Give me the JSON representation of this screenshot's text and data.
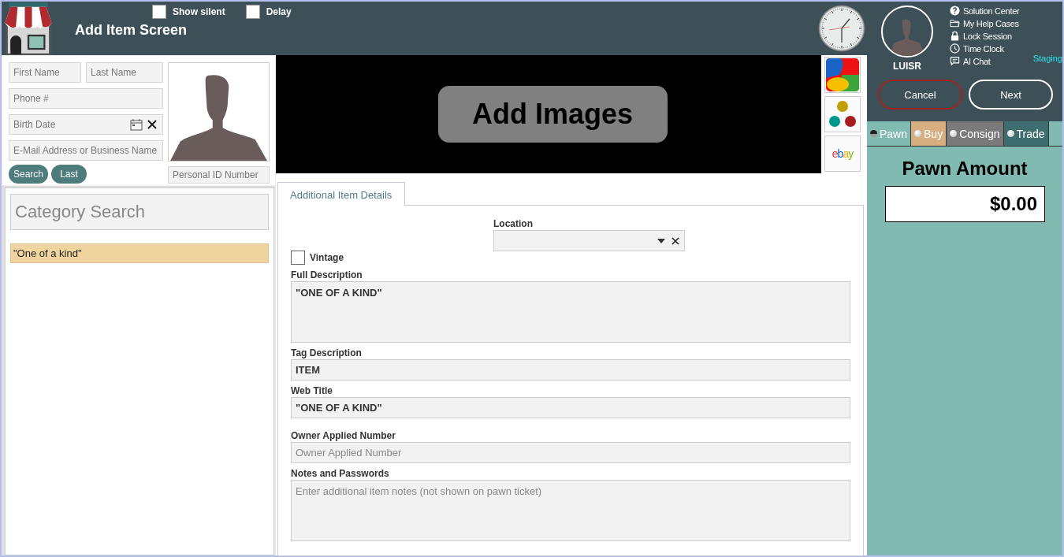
{
  "header": {
    "title": "Add Item Screen",
    "options": [
      {
        "label": "Show silent",
        "checked": false
      },
      {
        "label": "Delay",
        "checked": false
      }
    ]
  },
  "customer": {
    "fields": [
      {
        "placeholder": "First Name",
        "kind": "half"
      },
      {
        "placeholder": "Last Name",
        "kind": "half"
      },
      {
        "placeholder": "Phone #",
        "kind": "full"
      },
      {
        "placeholder": "Birth Date",
        "kind": "date"
      },
      {
        "placeholder": "E-Mail Address or Business Name",
        "kind": "full"
      }
    ],
    "buttons": [
      "Search",
      "Last"
    ],
    "id_field": {
      "placeholder": "Personal ID Number"
    }
  },
  "category": {
    "search_placeholder": "Category Search",
    "results": [
      {
        "label": "\"One of a kind\"",
        "selected": true
      }
    ]
  },
  "images": {
    "button": "Add Images",
    "sources": [
      {
        "kind": "tile"
      },
      {
        "kind": "dots"
      },
      {
        "kind": "wordmark",
        "label": "ebay"
      }
    ]
  },
  "details": {
    "tabs": [
      {
        "label": "Additional Item Details",
        "selected": true
      }
    ],
    "location": {
      "label": "Location"
    },
    "vintage": {
      "label": "Vintage",
      "checked": false
    },
    "fields": [
      {
        "label": "Full Description",
        "value": "\"ONE OF A KIND\"",
        "kind": "multiline"
      },
      {
        "label": "Tag Description",
        "value": "ITEM",
        "kind": "line"
      },
      {
        "label": "Web Title",
        "value": "\"ONE OF A KIND\"",
        "kind": "line"
      },
      {
        "label": "Owner Applied Number",
        "placeholder": "Owner Applied Number",
        "kind": "line"
      },
      {
        "label": "Notes and Passwords",
        "placeholder": "Enter additional item notes (not shown on pawn ticket)",
        "kind": "multiline"
      }
    ]
  },
  "user": {
    "name": "LUISR",
    "links": [
      {
        "label": "Solution Center",
        "kind": "help"
      },
      {
        "label": "My Help Cases",
        "kind": "folder"
      },
      {
        "label": "Lock Session",
        "kind": "lock"
      },
      {
        "label": "Time Clock",
        "kind": "clock"
      },
      {
        "label": "AI Chat",
        "kind": "chat"
      }
    ],
    "environment": "Staging"
  },
  "actions": [
    {
      "label": "Cancel",
      "kind": "cancel"
    },
    {
      "label": "Next",
      "kind": "next"
    }
  ],
  "transaction_tabs": [
    {
      "label": "Pawn",
      "selected": true,
      "color": "#80bab0"
    },
    {
      "label": "Buy",
      "selected": false,
      "color": "#d6ae80"
    },
    {
      "label": "Consign",
      "selected": false,
      "color": "#7a7a7a"
    },
    {
      "label": "Trade",
      "selected": false,
      "color": "#3e6d70"
    }
  ],
  "amount": {
    "label": "Pawn Amount",
    "value": "$0.00"
  }
}
